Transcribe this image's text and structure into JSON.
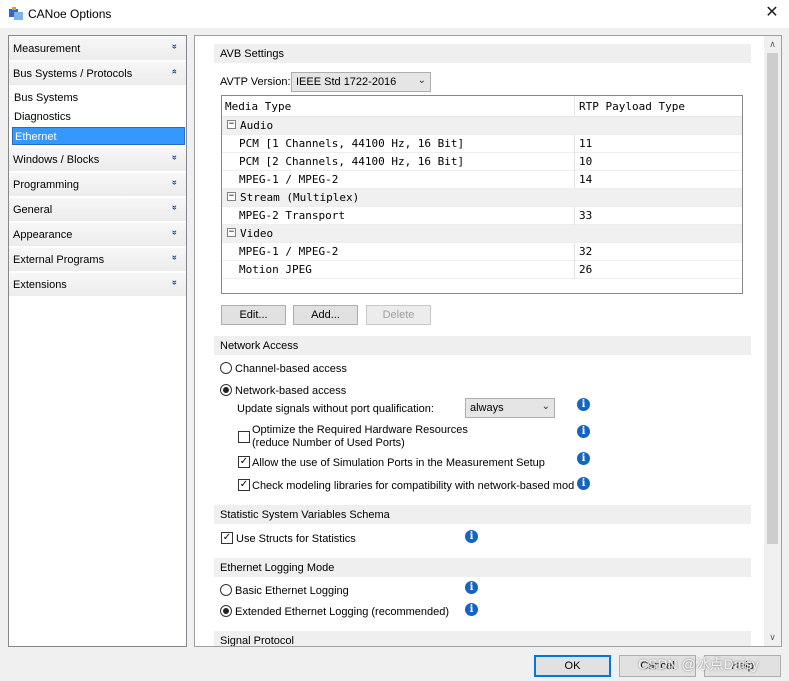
{
  "window": {
    "title": "CANoe Options"
  },
  "nav": {
    "categories": [
      {
        "label": "Measurement",
        "chevron": "»"
      },
      {
        "label": "Bus Systems / Protocols",
        "chevron": "«"
      },
      {
        "label": "Windows / Blocks",
        "chevron": "»"
      },
      {
        "label": "Programming",
        "chevron": "»"
      },
      {
        "label": "General",
        "chevron": "»"
      },
      {
        "label": "Appearance",
        "chevron": "»"
      },
      {
        "label": "External Programs",
        "chevron": "»"
      },
      {
        "label": "Extensions",
        "chevron": "»"
      }
    ],
    "sub_items": [
      {
        "label": "Bus Systems"
      },
      {
        "label": "Diagnostics"
      },
      {
        "label": "Ethernet",
        "selected": true
      }
    ]
  },
  "avb": {
    "section_title": "AVB Settings",
    "avtp_label": "AVTP Version:",
    "avtp_value": "IEEE Std 1722-2016",
    "grid": {
      "headers": [
        "Media Type",
        "RTP Payload Type"
      ],
      "rows": [
        {
          "group": true,
          "label": "Audio"
        },
        {
          "label": "PCM [1 Channels, 44100 Hz, 16 Bit]",
          "value": "11"
        },
        {
          "label": "PCM [2 Channels, 44100 Hz, 16 Bit]",
          "value": "10"
        },
        {
          "label": "MPEG-1 / MPEG-2",
          "value": "14"
        },
        {
          "group": true,
          "label": "Stream (Multiplex)"
        },
        {
          "label": "MPEG-2 Transport",
          "value": "33"
        },
        {
          "group": true,
          "label": "Video"
        },
        {
          "label": "MPEG-1 / MPEG-2",
          "value": "32"
        },
        {
          "label": "Motion JPEG",
          "value": "26"
        }
      ]
    },
    "buttons": {
      "edit": "Edit...",
      "add": "Add...",
      "delete": "Delete"
    }
  },
  "network": {
    "section_title": "Network Access",
    "channel_based": "Channel-based access",
    "network_based": "Network-based access",
    "update_label": "Update signals without port qualification:",
    "update_value": "always",
    "optimize_line1": "Optimize the Required Hardware Resources",
    "optimize_line2": "(reduce Number of Used Ports)",
    "allow_sim": "Allow the use of Simulation Ports in the Measurement Setup",
    "check_libs": "Check modeling libraries for compatibility with network-based mod"
  },
  "statistic": {
    "section_title": "Statistic System Variables Schema",
    "use_structs": "Use Structs for Statistics"
  },
  "logging": {
    "section_title": "Ethernet Logging Mode",
    "basic": "Basic Ethernet Logging",
    "extended": "Extended Ethernet Logging (recommended)"
  },
  "signal": {
    "section_title": "Signal Protocol"
  },
  "footer": {
    "ok": "OK",
    "cancel": "Cancel",
    "help": "Help"
  },
  "watermark": "CSDN @冰点Daisy",
  "glyphs": {
    "close": "✕",
    "dropdown": "⌵",
    "check": "✓",
    "info": "i",
    "scroll_up": "∧",
    "scroll_down": "∨",
    "collapse": "−"
  }
}
